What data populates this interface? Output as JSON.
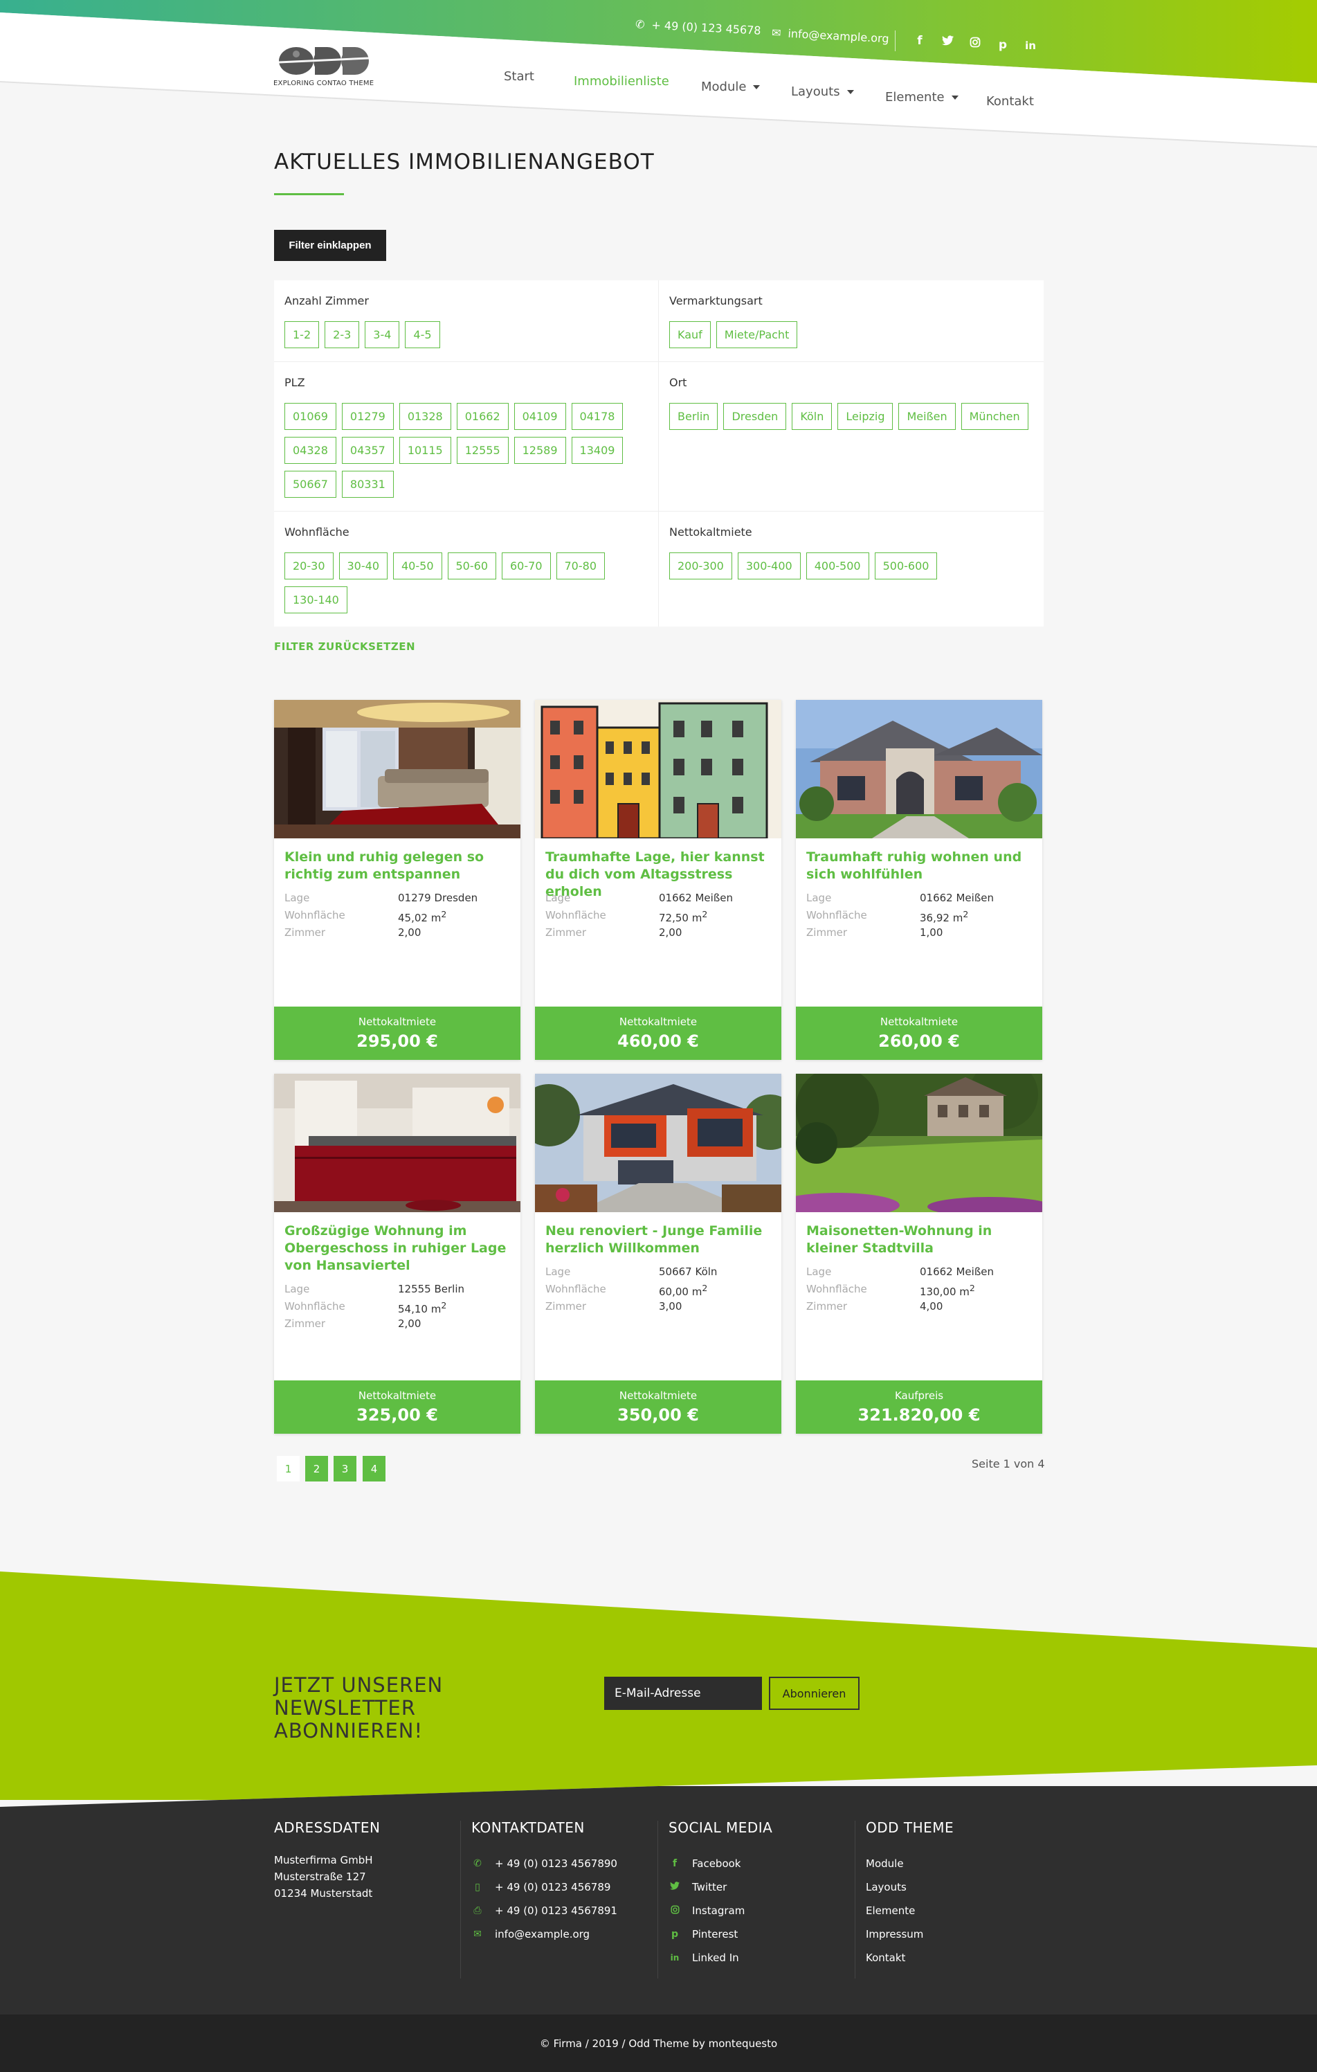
{
  "header": {
    "phone": "+ 49 (0) 123 45678",
    "email": "info@example.org",
    "logo_text": "ODD",
    "logo_tagline": "EXPLORING CONTAO THEME",
    "nav": [
      "Start",
      "Immobilienliste",
      "Module",
      "Layouts",
      "Elemente",
      "Kontakt"
    ],
    "active_nav": "Immobilienliste",
    "social_icons": [
      "facebook-icon",
      "twitter-icon",
      "instagram-icon",
      "pinterest-icon",
      "linkedin-icon"
    ]
  },
  "main": {
    "title": "AKTUELLES IMMOBILIENANGEBOT",
    "filter_toggle": "Filter einklappen",
    "filters": {
      "rooms": {
        "label": "Anzahl Zimmer",
        "options": [
          "1-2",
          "2-3",
          "3-4",
          "4-5"
        ]
      },
      "marketing": {
        "label": "Vermarktungsart",
        "options": [
          "Kauf",
          "Miete/Pacht"
        ]
      },
      "plz": {
        "label": "PLZ",
        "options": [
          "01069",
          "01279",
          "01328",
          "01662",
          "04109",
          "04178",
          "04328",
          "04357",
          "10115",
          "12555",
          "12589",
          "13409",
          "50667",
          "80331"
        ]
      },
      "ort": {
        "label": "Ort",
        "options": [
          "Berlin",
          "Dresden",
          "Köln",
          "Leipzig",
          "Meißen",
          "München"
        ]
      },
      "area": {
        "label": "Wohnfläche",
        "options": [
          "20-30",
          "30-40",
          "40-50",
          "50-60",
          "60-70",
          "70-80",
          "130-140"
        ]
      },
      "rent": {
        "label": "Nettokaltmiete",
        "options": [
          "200-300",
          "300-400",
          "400-500",
          "500-600"
        ]
      }
    },
    "reset": "FILTER ZURÜCKSETZEN",
    "field_labels": {
      "lage": "Lage",
      "wohnflaeche": "Wohnfläche",
      "zimmer": "Zimmer",
      "unit": "m",
      "unit_exp": "2"
    },
    "listings": [
      {
        "title": "Klein und ruhig gelegen so richtig zum entspannen",
        "lage": "01279 Dresden",
        "flaeche": "45,02",
        "zimmer": "2,00",
        "price_label": "Nettokaltmiete",
        "price": "295,00 €"
      },
      {
        "title": "Traumhafte Lage, hier kannst du dich vom Altagsstress erholen",
        "lage": "01662 Meißen",
        "flaeche": "72,50",
        "zimmer": "2,00",
        "price_label": "Nettokaltmiete",
        "price": "460,00 €"
      },
      {
        "title": "Traumhaft ruhig wohnen und sich wohlfühlen",
        "lage": "01662 Meißen",
        "flaeche": "36,92",
        "zimmer": "1,00",
        "price_label": "Nettokaltmiete",
        "price": "260,00 €"
      },
      {
        "title": "Großzügige Wohnung im Obergeschoss in ruhiger Lage von Hansaviertel",
        "lage": "12555 Berlin",
        "flaeche": "54,10",
        "zimmer": "2,00",
        "price_label": "Nettokaltmiete",
        "price": "325,00 €"
      },
      {
        "title": "Neu renoviert - Junge Familie herzlich Willkommen",
        "lage": "50667 Köln",
        "flaeche": "60,00",
        "zimmer": "3,00",
        "price_label": "Nettokaltmiete",
        "price": "350,00 €"
      },
      {
        "title": "Maisonetten-Wohnung in kleiner Stadtvilla",
        "lage": "01662 Meißen",
        "flaeche": "130,00",
        "zimmer": "4,00",
        "price_label": "Kaufpreis",
        "price": "321.820,00 €"
      }
    ],
    "pagination": {
      "pages": [
        "1",
        "2",
        "3",
        "4"
      ],
      "current": "1",
      "info": "Seite 1 von 4"
    }
  },
  "newsletter": {
    "title": "JETZT UNSEREN NEWSLETTER ABONNIEREN!",
    "placeholder": "E-Mail-Adresse",
    "button": "Abonnieren"
  },
  "footer": {
    "address": {
      "heading": "ADRESSDATEN",
      "lines": [
        "Musterfirma GmbH",
        "Musterstraße 127",
        "01234 Musterstadt"
      ]
    },
    "contact": {
      "heading": "KONTAKTDATEN",
      "items": [
        {
          "icon": "phone-icon",
          "text": "+ 49 (0) 0123 4567890"
        },
        {
          "icon": "mobile-icon",
          "text": "+ 49 (0) 0123 456789"
        },
        {
          "icon": "fax-icon",
          "text": "+ 49 (0) 0123 4567891"
        },
        {
          "icon": "envelope-icon",
          "text": "info@example.org"
        }
      ]
    },
    "social": {
      "heading": "SOCIAL MEDIA",
      "items": [
        {
          "icon": "facebook-icon",
          "text": "Facebook"
        },
        {
          "icon": "twitter-icon",
          "text": "Twitter"
        },
        {
          "icon": "instagram-icon",
          "text": "Instagram"
        },
        {
          "icon": "pinterest-icon",
          "text": "Pinterest"
        },
        {
          "icon": "linkedin-icon",
          "text": "Linked In"
        }
      ]
    },
    "theme": {
      "heading": "ODD THEME",
      "items": [
        "Module",
        "Layouts",
        "Elemente",
        "Impressum",
        "Kontakt"
      ]
    },
    "copyright": "© Firma / 2019 / Odd Theme by montequesto"
  },
  "colors": {
    "accent": "#5fbe43",
    "lime": "#a0c800",
    "teal": "#3aaf91",
    "dark": "#2f2f2f",
    "darker": "#232323"
  }
}
